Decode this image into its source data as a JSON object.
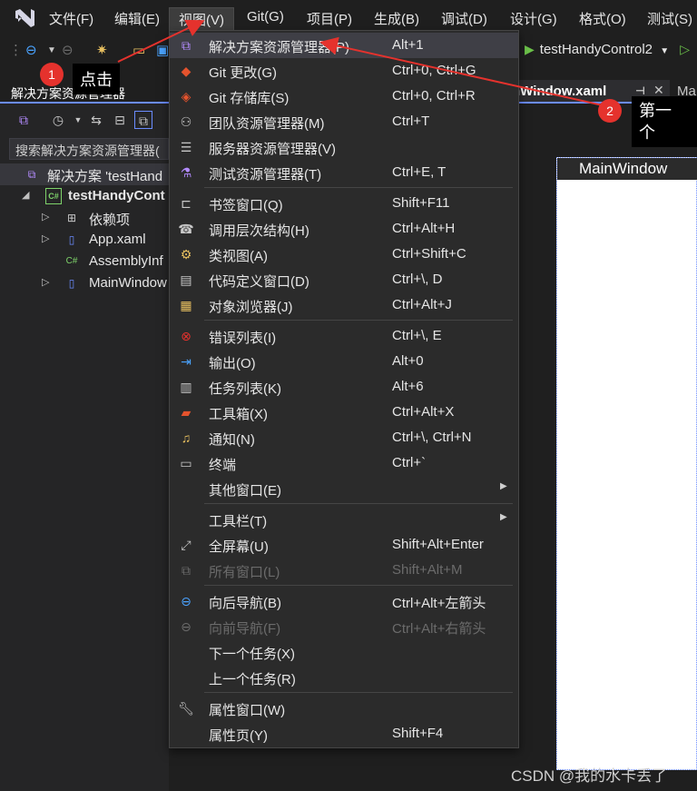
{
  "menubar": {
    "items": [
      "文件(F)",
      "编辑(E)",
      "视图(V)",
      "Git(G)",
      "项目(P)",
      "生成(B)",
      "调试(D)",
      "设计(G)",
      "格式(O)",
      "测试(S)"
    ]
  },
  "toolbar": {
    "run_target": "testHandyControl2"
  },
  "solution_explorer": {
    "title": "解决方案资源管理器",
    "search_placeholder": "搜索解决方案资源管理器(",
    "tree": [
      {
        "label": "解决方案 'testHand"
      },
      {
        "label": "testHandyCont"
      },
      {
        "label": "依赖项"
      },
      {
        "label": "App.xaml"
      },
      {
        "label": "AssemblyInf"
      },
      {
        "label": "MainWindow"
      }
    ]
  },
  "editor": {
    "tab_label": "nWindow.xaml",
    "tab2_label": "Ma",
    "designer_title": "MainWindow"
  },
  "view_menu": {
    "items": [
      {
        "label": "解决方案资源管理器(P)",
        "shortcut": "Alt+1",
        "icon": "solution-explorer-icon"
      },
      {
        "label": "Git 更改(G)",
        "shortcut": "Ctrl+0, Ctrl+G",
        "icon": "git-changes-icon"
      },
      {
        "label": "Git 存储库(S)",
        "shortcut": "Ctrl+0, Ctrl+R",
        "icon": "git-repository-icon"
      },
      {
        "label": "团队资源管理器(M)",
        "shortcut": "Ctrl+T",
        "icon": "team-explorer-icon"
      },
      {
        "label": "服务器资源管理器(V)",
        "shortcut": "",
        "icon": "server-explorer-icon"
      },
      {
        "label": "测试资源管理器(T)",
        "shortcut": "Ctrl+E, T",
        "icon": "test-explorer-icon"
      },
      {
        "label": "书签窗口(Q)",
        "shortcut": "Shift+F11",
        "icon": "bookmark-icon"
      },
      {
        "label": "调用层次结构(H)",
        "shortcut": "Ctrl+Alt+H",
        "icon": "call-hierarchy-icon"
      },
      {
        "label": "类视图(A)",
        "shortcut": "Ctrl+Shift+C",
        "icon": "class-view-icon"
      },
      {
        "label": "代码定义窗口(D)",
        "shortcut": "Ctrl+\\, D",
        "icon": "code-definition-icon"
      },
      {
        "label": "对象浏览器(J)",
        "shortcut": "Ctrl+Alt+J",
        "icon": "object-browser-icon"
      },
      {
        "label": "错误列表(I)",
        "shortcut": "Ctrl+\\, E",
        "icon": "error-list-icon"
      },
      {
        "label": "输出(O)",
        "shortcut": "Alt+0",
        "icon": "output-icon"
      },
      {
        "label": "任务列表(K)",
        "shortcut": "Alt+6",
        "icon": "task-list-icon"
      },
      {
        "label": "工具箱(X)",
        "shortcut": "Ctrl+Alt+X",
        "icon": "toolbox-icon"
      },
      {
        "label": "通知(N)",
        "shortcut": "Ctrl+\\, Ctrl+N",
        "icon": "bell-icon"
      },
      {
        "label": "终端",
        "shortcut": "Ctrl+`",
        "icon": "terminal-icon"
      },
      {
        "label": "其他窗口(E)",
        "shortcut": "",
        "icon": ""
      },
      {
        "label": "工具栏(T)",
        "shortcut": "",
        "icon": ""
      },
      {
        "label": "全屏幕(U)",
        "shortcut": "Shift+Alt+Enter",
        "icon": "fullscreen-icon"
      },
      {
        "label": "所有窗口(L)",
        "shortcut": "Shift+Alt+M",
        "icon": "all-windows-icon"
      },
      {
        "label": "向后导航(B)",
        "shortcut": "Ctrl+Alt+左箭头",
        "icon": "navigate-back-icon"
      },
      {
        "label": "向前导航(F)",
        "shortcut": "Ctrl+Alt+右箭头",
        "icon": "navigate-forward-icon"
      },
      {
        "label": "下一个任务(X)",
        "shortcut": "",
        "icon": ""
      },
      {
        "label": "上一个任务(R)",
        "shortcut": "",
        "icon": ""
      },
      {
        "label": "属性窗口(W)",
        "shortcut": "",
        "icon": "wrench-icon"
      },
      {
        "label": "属性页(Y)",
        "shortcut": "Shift+F4",
        "icon": ""
      }
    ]
  },
  "annotations": {
    "badge1": "1",
    "note1": "点击",
    "badge2": "2",
    "note2_line1": "第一",
    "note2_line2": "个"
  },
  "watermark": "CSDN @我的水卡丢了",
  "colors": {
    "background": "#1f1f1f",
    "menu_background": "#2b2b2b",
    "accent": "#6b8cff",
    "annotation_red": "#e5322d",
    "disabled_text": "#6b6b6b"
  }
}
